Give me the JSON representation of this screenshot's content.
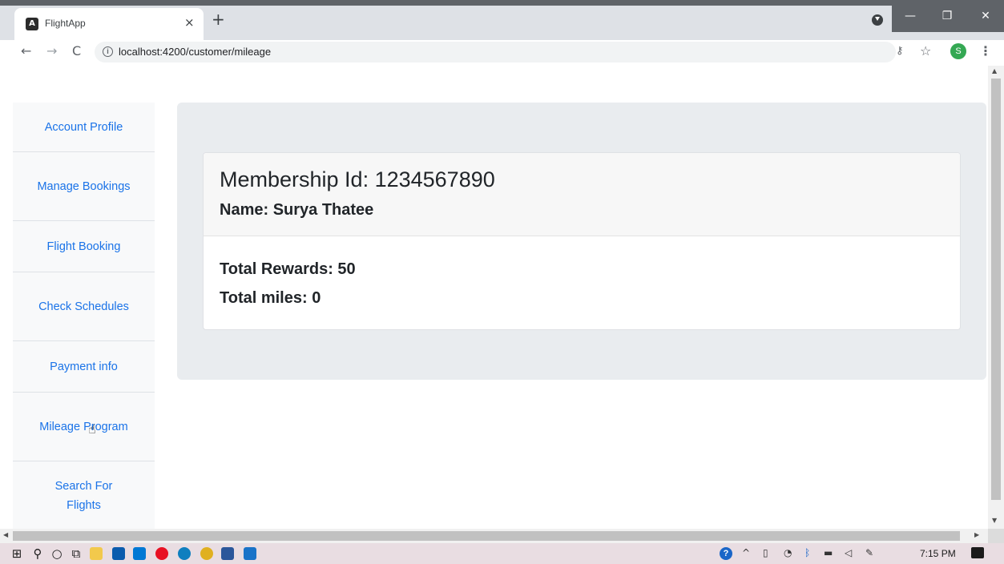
{
  "browser": {
    "tab_title": "FlightApp",
    "tab_favicon_letter": "A",
    "tab_close": "×",
    "new_tab": "+",
    "url_host": "localhost",
    "url_rest": ":4200/customer/mileage",
    "info_glyph": "i",
    "back_glyph": "←",
    "forward_glyph": "→",
    "reload_glyph": "C",
    "key_glyph": "⚷",
    "star_glyph": "☆",
    "avatar_letter": "S",
    "menu_glyph": "⋮",
    "win_min": "—",
    "win_max": "❐",
    "win_close": "✕"
  },
  "sidebar": {
    "items": [
      {
        "label": "Account Profile"
      },
      {
        "label": "Manage Bookings"
      },
      {
        "label": "Flight Booking"
      },
      {
        "label": "Check Schedules"
      },
      {
        "label": "Payment info"
      },
      {
        "label": "Mileage Program"
      },
      {
        "label": "Search For Flights"
      }
    ]
  },
  "card": {
    "membership": "Membership Id: 1234567890",
    "name": "Name: Surya Thatee",
    "rewards": "Total Rewards: 50",
    "miles": "Total miles: 0"
  },
  "taskbar": {
    "time": "7:15 PM",
    "help_glyph": "?",
    "chevron_glyph": "^"
  },
  "colors": {
    "link": "#1a73e8",
    "jumbotron": "#e9ecef",
    "sidebar": "#f8f9fa"
  }
}
